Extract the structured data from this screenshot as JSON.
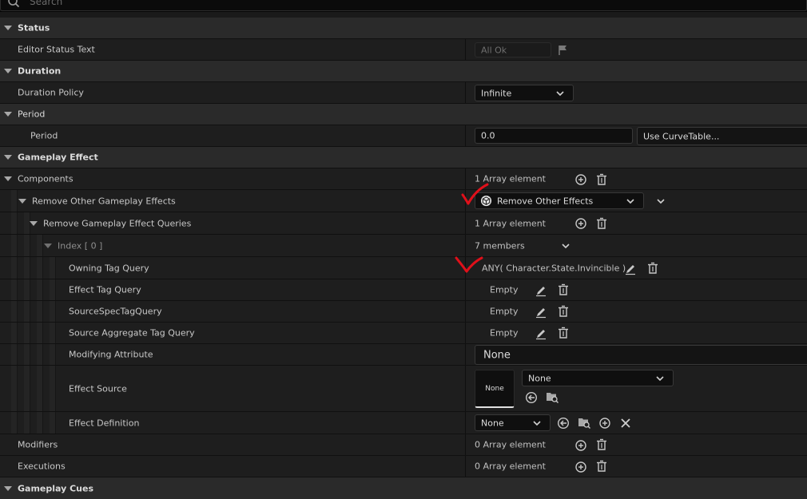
{
  "search": {
    "placeholder": "Search"
  },
  "rows": {
    "status_cat": "Status",
    "editor_status_text": {
      "label": "Editor Status Text",
      "value": "All Ok"
    },
    "duration_cat": "Duration",
    "duration_policy": {
      "label": "Duration Policy",
      "value": "Infinite"
    },
    "period_cat": "Period",
    "period": {
      "label": "Period",
      "value": "0.0",
      "curve_button": "Use CurveTable..."
    },
    "gameplay_effect_cat": "Gameplay Effect",
    "components": {
      "label": "Components",
      "value": "1 Array element"
    },
    "remove_other_ge": {
      "label": "Remove Other Gameplay Effects",
      "value": "Remove Other Effects"
    },
    "remove_ge_queries": {
      "label": "Remove Gameplay Effect Queries",
      "value": "1 Array element"
    },
    "index0": {
      "label": "Index [ 0 ]",
      "value": "7 members"
    },
    "owning_tag_query": {
      "label": "Owning Tag Query",
      "value": "ANY( Character.State.Invincible )"
    },
    "effect_tag_query": {
      "label": "Effect Tag Query",
      "value": "Empty"
    },
    "source_spec_tag_query": {
      "label": "SourceSpecTagQuery",
      "value": "Empty"
    },
    "source_agg_tag_query": {
      "label": "Source Aggregate Tag Query",
      "value": "Empty"
    },
    "modifying_attribute": {
      "label": "Modifying Attribute",
      "value": "None"
    },
    "effect_source": {
      "label": "Effect Source",
      "thumb": "None",
      "value": "None"
    },
    "effect_definition": {
      "label": "Effect Definition",
      "value": "None"
    },
    "modifiers": {
      "label": "Modifiers",
      "value": "0 Array element"
    },
    "executions": {
      "label": "Executions",
      "value": "0 Array element"
    },
    "gameplay_cues_cat": "Gameplay Cues"
  },
  "colors": {
    "annotation": "#e0101a",
    "category_bg": "#2a2a2a",
    "row_bg": "#1e1e1e",
    "input_bg": "#0f0f0f"
  },
  "icons": [
    "search-icon",
    "flag-icon",
    "chevron-down-icon",
    "add-icon",
    "trash-icon",
    "component-icon",
    "edit-icon",
    "browse-back-icon",
    "find-in-browser-icon",
    "clear-icon",
    "checkmark-annotation"
  ]
}
